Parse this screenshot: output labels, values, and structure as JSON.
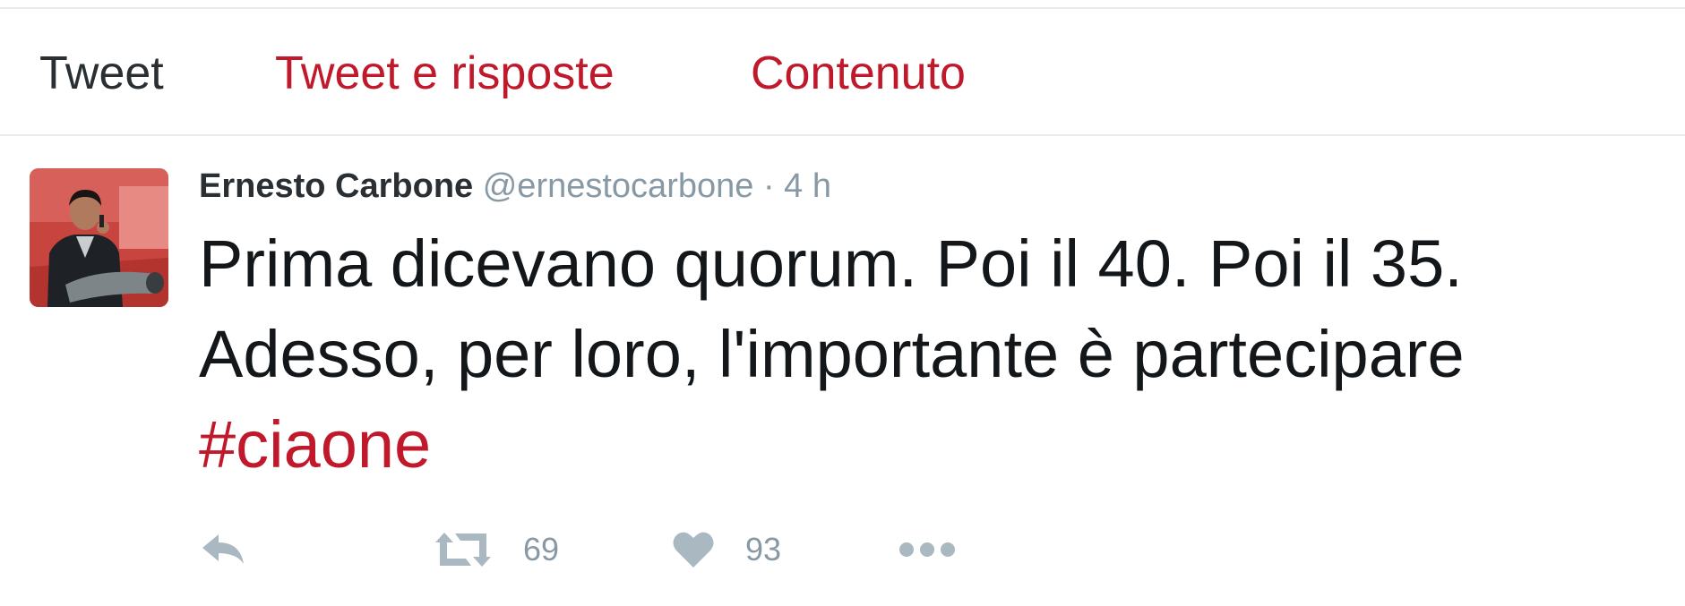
{
  "tabs": [
    {
      "label": "Tweet",
      "active": true
    },
    {
      "label": "Tweet e risposte",
      "active": false
    },
    {
      "label": "Contenuto",
      "active": false
    }
  ],
  "tweet": {
    "author_name": "Ernesto Carbone",
    "author_handle": "@ernestocarbone",
    "separator": "·",
    "time": "4 h",
    "text": "Prima dicevano quorum. Poi il 40. Poi il 35. Adesso, per loro, l'importante è partecipare",
    "hashtag": "#ciaone",
    "retweet_count": "69",
    "like_count": "93"
  },
  "icons": {
    "reply": "reply-icon",
    "retweet": "retweet-icon",
    "like": "heart-icon",
    "more": "more-icon"
  },
  "colors": {
    "accent": "#c0192b",
    "text": "#14171a",
    "muted": "#8899a6",
    "divider": "#e6ecf0"
  }
}
